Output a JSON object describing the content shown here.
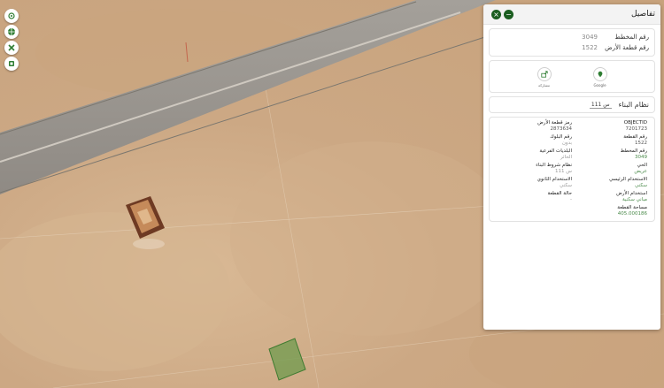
{
  "map": {
    "controls": [
      {
        "name": "locate-icon"
      },
      {
        "name": "globe-icon"
      },
      {
        "name": "tools-icon"
      },
      {
        "name": "layers-icon"
      }
    ]
  },
  "panel": {
    "title": "تفاصيل",
    "summary": {
      "plan_label": "رقم المخطط",
      "plan_value": "3049",
      "parcel_label": "رقم قطعة الأرض",
      "parcel_value": "1522"
    },
    "buttons": {
      "google_label": "Google",
      "share_label": "مشاركة"
    },
    "building_system": {
      "label": "نظام البناء",
      "value": "س 111"
    },
    "attributes": [
      {
        "label": "OBJECTID",
        "value": "7201723",
        "style": "dark"
      },
      {
        "label": "رمز قطعة الأرض",
        "value": "2873634",
        "style": "dark"
      },
      {
        "label": "رقم القطعة",
        "value": "1522",
        "style": "dark"
      },
      {
        "label": "رقم البلوك",
        "value": "بدون",
        "style": "grey"
      },
      {
        "label": "رقم المخطط",
        "value": "3049",
        "style": "green"
      },
      {
        "label": "البلديات الفرعية",
        "value": "الحائر",
        "style": "grey"
      },
      {
        "label": "الحي",
        "value": "عريض",
        "style": "green"
      },
      {
        "label": "نظام شروط البناء",
        "value": "س 111",
        "style": "grey"
      },
      {
        "label": "الاستخدام الرئيسي",
        "value": "سكني",
        "style": "green"
      },
      {
        "label": "الاستخدام الثانوي",
        "value": "سكني",
        "style": "grey"
      },
      {
        "label": "استخدام الأرض",
        "value": "مباني سكنية",
        "style": "green"
      },
      {
        "label": "حالة القطعة",
        "value": "-",
        "style": "grey"
      },
      {
        "label": "مساحة القطعة",
        "value": "405.000186",
        "style": "green"
      },
      {
        "label": "",
        "value": "",
        "style": "grey"
      }
    ]
  }
}
